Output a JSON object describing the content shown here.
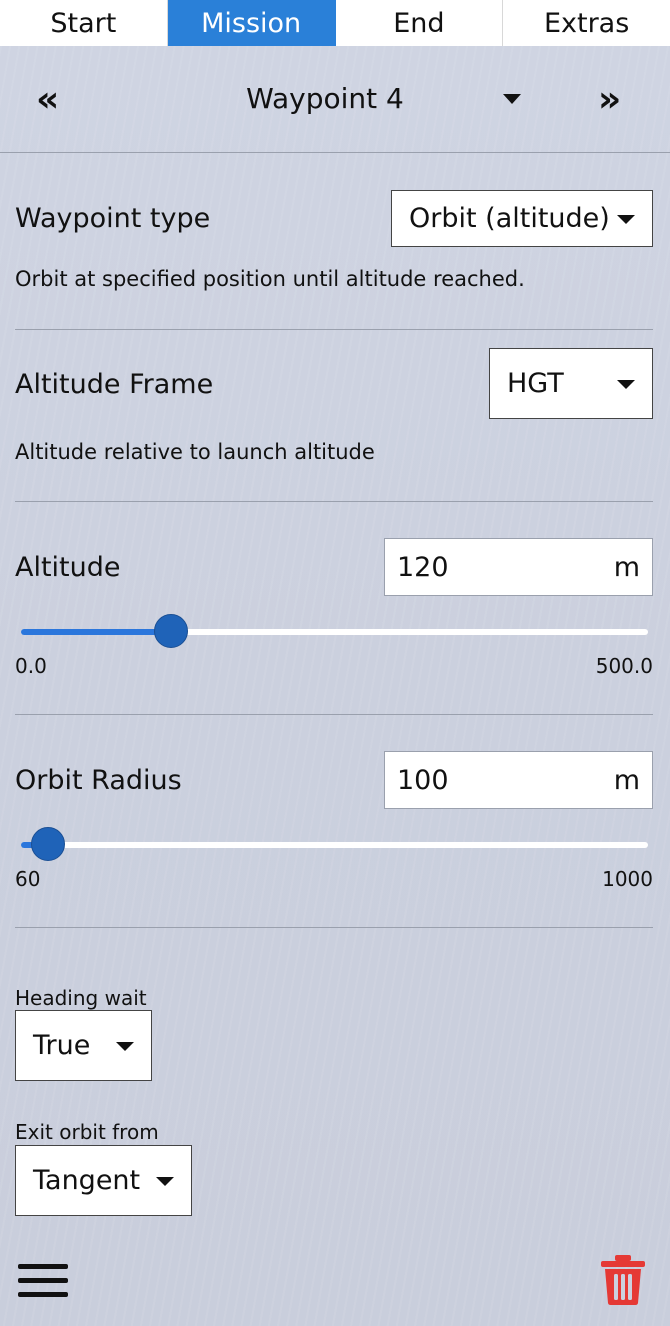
{
  "tabs": [
    {
      "label": "Start",
      "active": false
    },
    {
      "label": "Mission",
      "active": true
    },
    {
      "label": "End",
      "active": false
    },
    {
      "label": "Extras",
      "active": false
    }
  ],
  "waypoint_nav": {
    "prev_icon": "double-chevron-left",
    "prev_glyph": "«",
    "title": "Waypoint 4",
    "next_icon": "double-chevron-right",
    "next_glyph": "»"
  },
  "waypoint_type": {
    "label": "Waypoint type",
    "value": "Orbit (altitude)",
    "description": "Orbit at specified position until altitude reached."
  },
  "altitude_frame": {
    "label": "Altitude Frame",
    "value": "HGT",
    "description": "Altitude relative to launch altitude"
  },
  "altitude": {
    "label": "Altitude",
    "value": "120",
    "unit": "m",
    "slider_min": "0.0",
    "slider_max": "500.0",
    "slider_fraction": 0.24
  },
  "orbit_radius": {
    "label": "Orbit Radius",
    "value": "100",
    "unit": "m",
    "slider_min": "60",
    "slider_max": "1000",
    "slider_fraction": 0.043
  },
  "heading_wait": {
    "label": "Heading wait",
    "value": "True"
  },
  "exit_orbit": {
    "label": "Exit orbit from",
    "value": "Tangent"
  },
  "bottom_bar": {
    "menu_icon": "hamburger-menu",
    "delete_icon": "trash",
    "delete_color": "#e53935"
  },
  "colors": {
    "accent": "#2a80d8",
    "slider_knob": "#1f63b8"
  }
}
